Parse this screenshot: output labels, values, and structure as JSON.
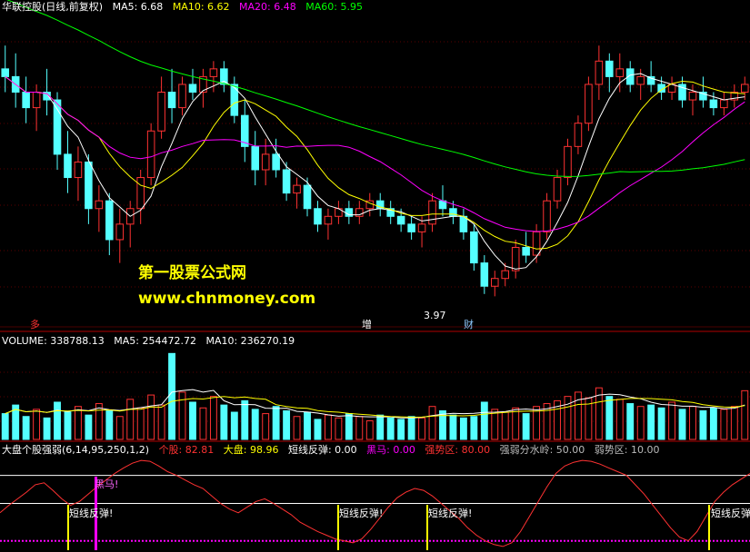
{
  "title": "华联控股(日线,前复权)",
  "price_header": {
    "ma5_label": "MA5: 6.68",
    "ma10_label": "MA10: 6.62",
    "ma20_label": "MA20: 6.48",
    "ma60_label": "MA60: 5.95"
  },
  "volume_header": {
    "volume_label": "VOLUME: 338788.13",
    "ma5_label": "MA5: 254472.72",
    "ma10_label": "MA10: 236270.19"
  },
  "indicator_header": {
    "name": "大盘个股强弱(6,14,95,250,1,2)",
    "individual": "个股: 82.81",
    "market": "大盘: 98.96",
    "rebound": "短线反弹: 0.00",
    "darkhorse": "黑马: 0.00",
    "strong_zone": "强势区: 80.00",
    "watershed": "强弱分水岭: 50.00",
    "weak_zone": "弱势区: 10.00"
  },
  "watermark": {
    "line1": "第一股票公式网",
    "line2": "www.chnmoney.com"
  },
  "annotations": {
    "low_price": "3.97",
    "marker_left": "多",
    "marker_mid": "增",
    "marker_right": "财",
    "darkhorse_label": "黑马!",
    "rebound_label": "短线反弹!"
  },
  "colors": {
    "background": "#000000",
    "up_candle": "#ff3232",
    "down_candle": "#54ffff",
    "ma5": "#ffffff",
    "ma10": "#ffff00",
    "ma20": "#ff00ff",
    "ma60": "#00ff00",
    "separator": "#b00000",
    "individual_line": "#ff3232",
    "strong_line": "#ffffff",
    "weak_line": "#ff00ff",
    "darkhorse_bar": "#ff00ff",
    "rebound_bar": "#ffff00"
  },
  "chart_data": [
    {
      "type": "candlestick",
      "title": "华联控股(日线,前复权)",
      "series": [
        {
          "name": "MA5",
          "value": 6.68
        },
        {
          "name": "MA10",
          "value": 6.62
        },
        {
          "name": "MA20",
          "value": 6.48
        },
        {
          "name": "MA60",
          "value": 5.95
        }
      ],
      "min_price_label": 3.97,
      "note_values": "bars approximated from image; y in price units",
      "ohlc": [
        [
          6.9,
          7.2,
          6.6,
          6.8
        ],
        [
          6.8,
          7.1,
          6.4,
          6.6
        ],
        [
          6.6,
          6.8,
          6.2,
          6.4
        ],
        [
          6.4,
          6.7,
          6.1,
          6.6
        ],
        [
          6.6,
          6.9,
          6.3,
          6.5
        ],
        [
          6.5,
          6.6,
          5.6,
          5.8
        ],
        [
          5.8,
          6.1,
          5.3,
          5.5
        ],
        [
          5.5,
          5.9,
          5.2,
          5.7
        ],
        [
          5.7,
          5.8,
          4.9,
          5.1
        ],
        [
          5.1,
          5.4,
          4.8,
          5.2
        ],
        [
          5.2,
          5.3,
          4.5,
          4.7
        ],
        [
          4.7,
          5.1,
          4.4,
          4.9
        ],
        [
          4.9,
          5.2,
          4.6,
          5.1
        ],
        [
          5.1,
          5.6,
          4.9,
          5.5
        ],
        [
          5.5,
          6.2,
          5.4,
          6.1
        ],
        [
          6.1,
          6.8,
          6.0,
          6.6
        ],
        [
          6.6,
          6.9,
          6.2,
          6.4
        ],
        [
          6.4,
          6.8,
          6.3,
          6.7
        ],
        [
          6.7,
          6.9,
          6.5,
          6.6
        ],
        [
          6.6,
          6.9,
          6.4,
          6.8
        ],
        [
          6.8,
          7.0,
          6.6,
          6.9
        ],
        [
          6.9,
          7.0,
          6.6,
          6.7
        ],
        [
          6.7,
          6.8,
          6.2,
          6.3
        ],
        [
          6.3,
          6.5,
          5.7,
          5.9
        ],
        [
          5.9,
          6.1,
          5.4,
          5.6
        ],
        [
          5.6,
          6.0,
          5.4,
          5.8
        ],
        [
          5.8,
          6.0,
          5.5,
          5.6
        ],
        [
          5.6,
          5.7,
          5.2,
          5.3
        ],
        [
          5.3,
          5.5,
          5.1,
          5.4
        ],
        [
          5.4,
          5.5,
          5.0,
          5.1
        ],
        [
          5.1,
          5.2,
          4.8,
          4.9
        ],
        [
          4.9,
          5.1,
          4.7,
          5.0
        ],
        [
          5.0,
          5.2,
          4.9,
          5.1
        ],
        [
          5.1,
          5.2,
          4.9,
          5.0
        ],
        [
          5.0,
          5.2,
          4.9,
          5.1
        ],
        [
          5.1,
          5.3,
          5.0,
          5.2
        ],
        [
          5.2,
          5.3,
          5.0,
          5.1
        ],
        [
          5.1,
          5.2,
          4.9,
          5.0
        ],
        [
          5.0,
          5.1,
          4.8,
          4.9
        ],
        [
          4.9,
          5.0,
          4.7,
          4.8
        ],
        [
          4.8,
          5.0,
          4.6,
          4.9
        ],
        [
          4.9,
          5.3,
          4.8,
          5.2
        ],
        [
          5.2,
          5.4,
          5.0,
          5.1
        ],
        [
          5.1,
          5.2,
          4.9,
          5.0
        ],
        [
          5.0,
          5.1,
          4.7,
          4.8
        ],
        [
          4.8,
          4.9,
          4.3,
          4.4
        ],
        [
          4.4,
          4.5,
          4.0,
          4.1
        ],
        [
          4.1,
          4.3,
          3.97,
          4.2
        ],
        [
          4.2,
          4.4,
          4.1,
          4.3
        ],
        [
          4.3,
          4.7,
          4.2,
          4.6
        ],
        [
          4.6,
          4.8,
          4.4,
          4.5
        ],
        [
          4.5,
          4.9,
          4.4,
          4.8
        ],
        [
          4.8,
          5.3,
          4.7,
          5.2
        ],
        [
          5.2,
          5.6,
          5.1,
          5.5
        ],
        [
          5.5,
          6.0,
          5.4,
          5.9
        ],
        [
          5.9,
          6.3,
          5.8,
          6.2
        ],
        [
          6.2,
          6.8,
          6.1,
          6.7
        ],
        [
          6.7,
          7.2,
          6.5,
          7.0
        ],
        [
          7.0,
          7.1,
          6.6,
          6.8
        ],
        [
          6.8,
          7.1,
          6.6,
          6.9
        ],
        [
          6.9,
          7.0,
          6.6,
          6.7
        ],
        [
          6.7,
          6.9,
          6.5,
          6.8
        ],
        [
          6.8,
          7.0,
          6.6,
          6.7
        ],
        [
          6.7,
          6.8,
          6.5,
          6.6
        ],
        [
          6.6,
          6.8,
          6.5,
          6.7
        ],
        [
          6.7,
          6.8,
          6.4,
          6.5
        ],
        [
          6.5,
          6.7,
          6.3,
          6.6
        ],
        [
          6.6,
          6.8,
          6.4,
          6.5
        ],
        [
          6.5,
          6.6,
          6.3,
          6.4
        ],
        [
          6.4,
          6.6,
          6.3,
          6.5
        ],
        [
          6.5,
          6.7,
          6.4,
          6.6
        ],
        [
          6.6,
          6.8,
          6.5,
          6.7
        ]
      ]
    },
    {
      "type": "bar",
      "title": "VOLUME",
      "series": [
        {
          "name": "VOLUME",
          "value": 338788.13
        },
        {
          "name": "MA5",
          "value": 254472.72
        },
        {
          "name": "MA10",
          "value": 236270.19
        }
      ],
      "values": [
        180000,
        240000,
        160000,
        210000,
        150000,
        260000,
        190000,
        230000,
        170000,
        250000,
        200000,
        160000,
        280000,
        220000,
        310000,
        240000,
        600000,
        330000,
        260000,
        220000,
        300000,
        240000,
        190000,
        270000,
        210000,
        180000,
        230000,
        200000,
        160000,
        190000,
        140000,
        170000,
        150000,
        180000,
        160000,
        130000,
        170000,
        150000,
        140000,
        160000,
        150000,
        230000,
        200000,
        170000,
        150000,
        160000,
        260000,
        210000,
        190000,
        220000,
        180000,
        230000,
        250000,
        270000,
        300000,
        330000,
        290000,
        360000,
        300000,
        280000,
        250000,
        230000,
        240000,
        220000,
        260000,
        210000,
        230000,
        200000,
        220000,
        210000,
        230000,
        340000
      ]
    },
    {
      "type": "line",
      "title": "大盘个股强弱(6,14,95,250,1,2)",
      "series": [
        {
          "name": "个股",
          "value": 82.81
        },
        {
          "name": "大盘",
          "value": 98.96
        },
        {
          "name": "短线反弹",
          "value": 0.0
        },
        {
          "name": "黑马",
          "value": 0.0
        },
        {
          "name": "强势区",
          "value": 80.0
        },
        {
          "name": "强弱分水岭",
          "value": 50.0
        },
        {
          "name": "弱势区",
          "value": 10.0
        }
      ],
      "individual_line": [
        40,
        48,
        55,
        62,
        70,
        72,
        64,
        55,
        48,
        52,
        60,
        68,
        75,
        82,
        88,
        93,
        96,
        95,
        90,
        84,
        80,
        75,
        70,
        66,
        58,
        50,
        44,
        40,
        46,
        52,
        55,
        50,
        44,
        38,
        30,
        25,
        20,
        16,
        12,
        10,
        8,
        12,
        22,
        34,
        46,
        56,
        62,
        66,
        64,
        58,
        50,
        42,
        34,
        24,
        16,
        10,
        6,
        4,
        8,
        20,
        36,
        52,
        68,
        82,
        90,
        94,
        96,
        95,
        92,
        88,
        84,
        80,
        70,
        60,
        48,
        36,
        24,
        14,
        10,
        20,
        36,
        52,
        62,
        70,
        76,
        82
      ],
      "darkhorse_signal_index": 12,
      "rebound_signal_indices": [
        8,
        44,
        55,
        91
      ]
    }
  ]
}
